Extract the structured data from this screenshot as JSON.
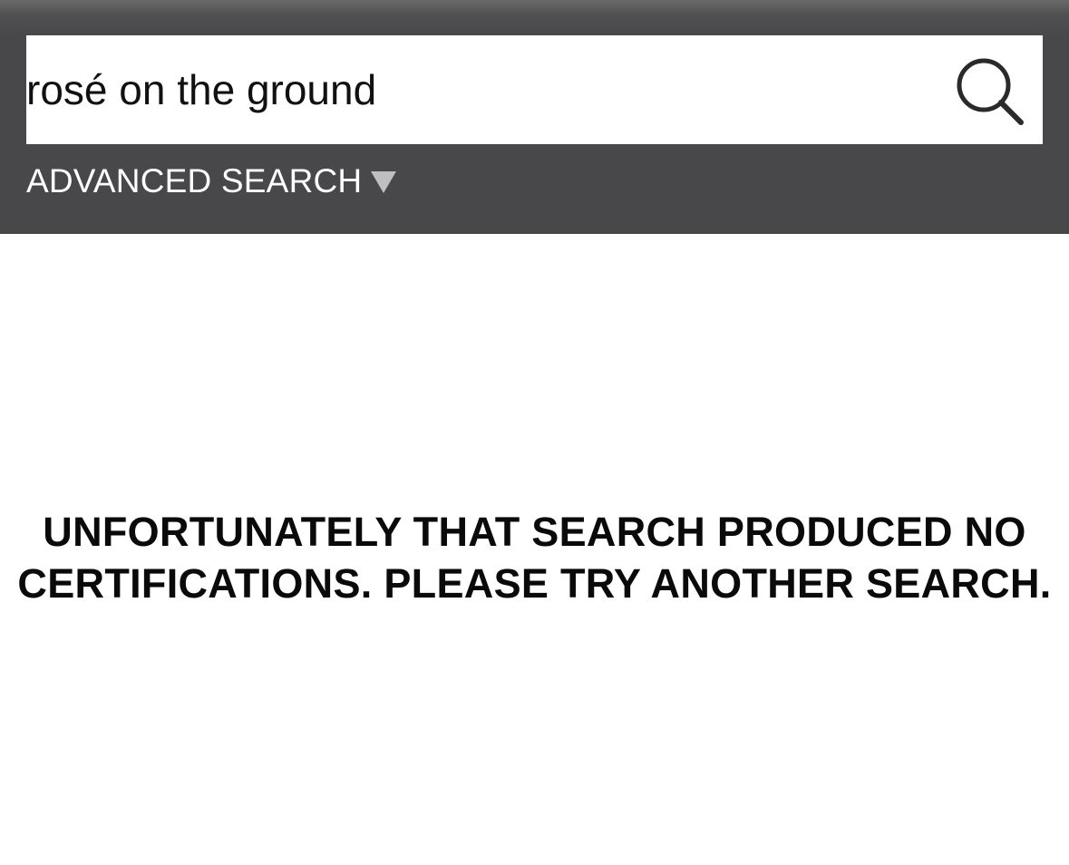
{
  "search": {
    "value": "rosé on the ground",
    "placeholder": ""
  },
  "icons": {
    "search_button": "search-icon",
    "advanced_toggle": "triangle-down-icon"
  },
  "advanced_search": {
    "label": "ADVANCED SEARCH"
  },
  "results": {
    "message_line_1": "UNFORTUNATELY THAT SEARCH PRODUCED NO",
    "message_line_2": "CERTIFICATIONS. PLEASE TRY ANOTHER SEARCH."
  },
  "colors": {
    "header_background": "#48474a",
    "page_background": "#ffffff",
    "text": "#0a0a0a",
    "advanced_label": "#ffffff",
    "dropdown_arrow": "#bfbfbf"
  }
}
